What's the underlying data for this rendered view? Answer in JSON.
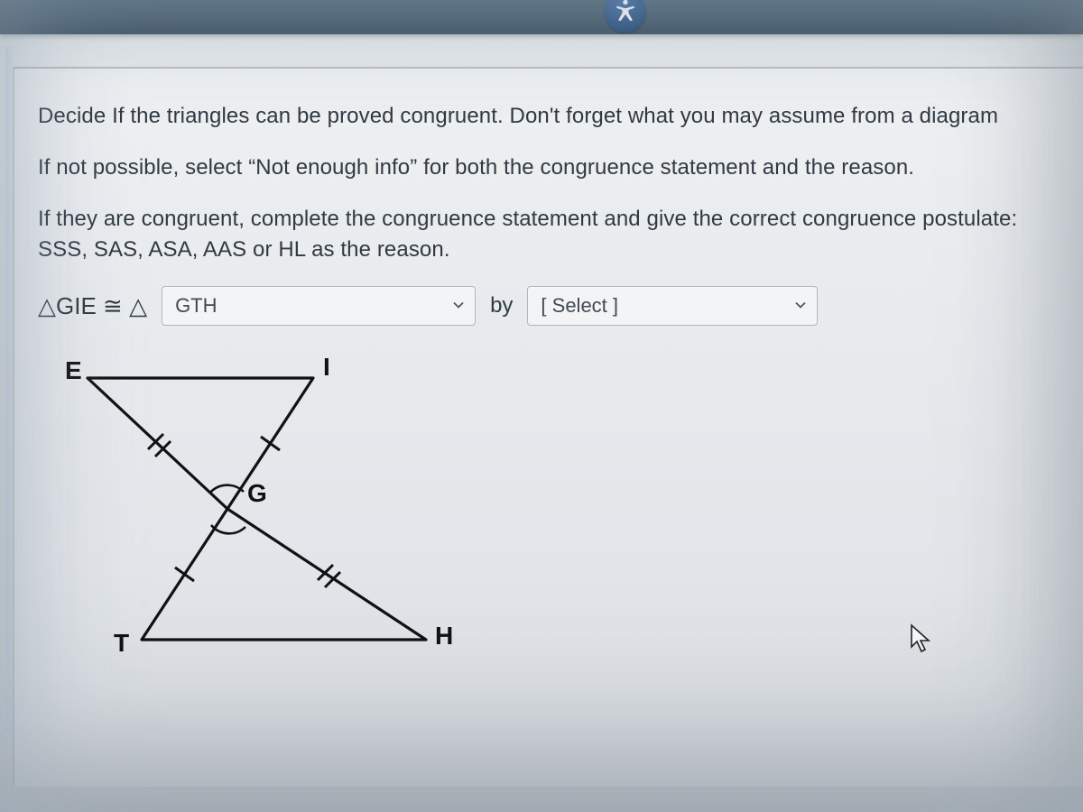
{
  "question": {
    "p1": "Decide If the triangles can be proved congruent. Don't forget what you may assume from a diagram",
    "p2": "If not possible, select “Not enough info” for both the congruence statement and the reason.",
    "p3": "If they are congruent, complete the congruence statement and give the correct congruence postulate: SSS, SAS, ASA, AAS or HL as the reason."
  },
  "answer": {
    "prefix_symbol": "△",
    "prefix_triangle": "GIE",
    "congr_symbol": "≅",
    "delta_symbol": "△",
    "dropdown1_value": "GTH",
    "by_label": "by",
    "dropdown2_value": "[ Select ]"
  },
  "diagram": {
    "vertices": {
      "E": "E",
      "I": "I",
      "G": "G",
      "T": "T",
      "H": "H"
    }
  },
  "icons": {
    "accessibility": "accessibility-icon",
    "chevron": "chevron-down-icon",
    "cursor": "cursor-icon"
  }
}
